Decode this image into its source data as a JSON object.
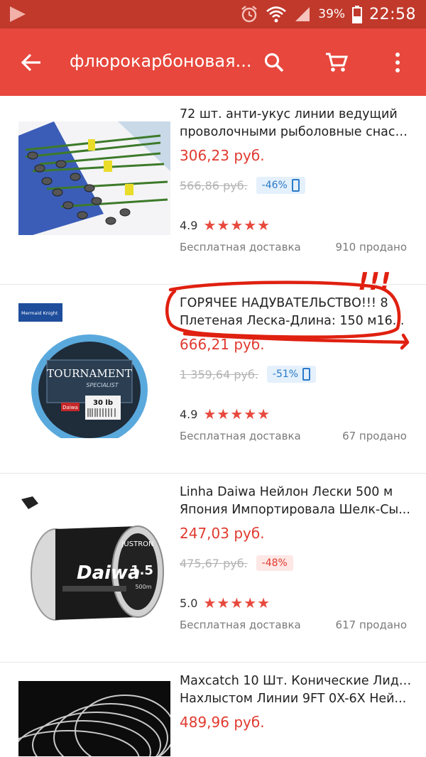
{
  "status": {
    "battery": "39%",
    "time": "22:58"
  },
  "appbar": {
    "query": "флюрокарбоновая..."
  },
  "colors": {
    "primary": "#e7473c",
    "status": "#c0392b",
    "price": "#e03a2f"
  },
  "items": [
    {
      "title_line1": "72 шт. анти-укус линии ведущий",
      "title_line2": "проволочными рыболовные снаст...",
      "price": "306,23 руб.",
      "old_price": "566,86 руб.",
      "discount": "-46%",
      "rating": "4.9",
      "shipping": "Бесплатная доставка",
      "sold": "910 продано"
    },
    {
      "title_line1": "ГОРЯЧЕЕ НАДУВАТЕЛЬСТВО!!! 8",
      "title_line2": "Плетеная Леска-Длина: 150 м16...",
      "price": "666,21 руб.",
      "old_price": "1 359,64 руб.",
      "discount": "-51%",
      "rating": "4.9",
      "shipping": "Бесплатная доставка",
      "sold": "67 продано",
      "brand_logo": "Mermaid Knight",
      "spool_brand": "TOURNAMENT",
      "spool_sub": "SPECIALIST",
      "spool_lb": "30 lb",
      "spool_maker": "Daiwa"
    },
    {
      "title_line1": "Linha Daiwa Нейлон Лески 500 м",
      "title_line2": "Япония Импортировала Шелк-Сы...",
      "price": "247,03 руб.",
      "old_price": "475,67 руб.",
      "discount": "-48%",
      "rating": "5.0",
      "shipping": "Бесплатная доставка",
      "sold": "617 продано",
      "spool_brand": "Daiwa",
      "spool_label": "JUSTRON",
      "spool_size": "1.5",
      "spool_len": "500m"
    },
    {
      "title_line1": "Maxcatch 10 Шт. Конические Лидер",
      "title_line2": "Нахлыстом Линии 9FT 0X-6X Ней...",
      "price": "489,96 руб."
    }
  ],
  "annotation": {
    "text": "!!!"
  },
  "stars_text": "★★★★★"
}
